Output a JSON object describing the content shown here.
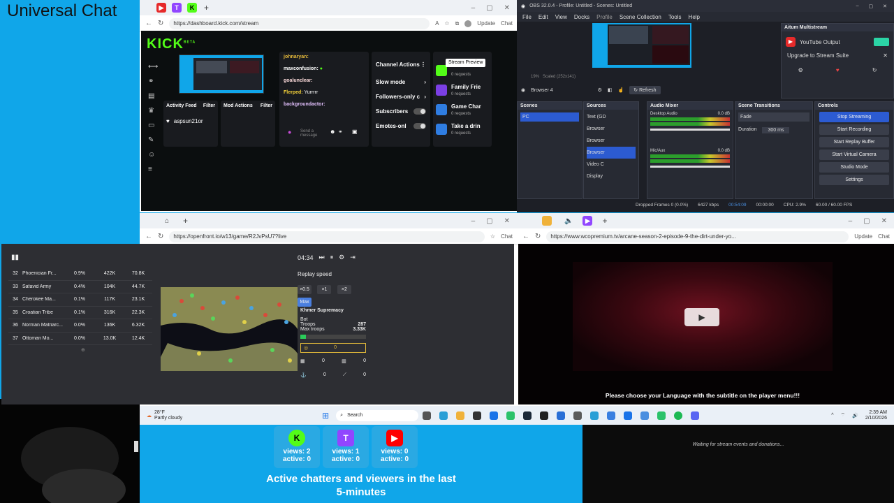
{
  "left": {
    "title": "Universal Chat"
  },
  "kick_browser": {
    "url": "https://dashboard.kick.com/stream",
    "update_label": "Update",
    "chat_label": "Chat",
    "logo": "KICK",
    "logo_badge": "BETA",
    "activity_feed": "Activity Feed",
    "filter": "Filter",
    "mod_actions": "Mod Actions",
    "sidebar_user": "aspsun21or",
    "chat": [
      {
        "user": "johnaryan:",
        "msg": ""
      },
      {
        "user": "maxconfusion:",
        "msg": ""
      },
      {
        "user": "goalunclear:",
        "msg": ""
      },
      {
        "user": "Flerped:",
        "msg": "Yurrrrr"
      },
      {
        "user": "backgroundactor:",
        "msg": ""
      }
    ],
    "send_placeholder": "Send a message",
    "channel_actions": "Channel Actions",
    "actions": [
      "Slow mode",
      "Followers-only c",
      "Subscribers",
      "Emotes-onl"
    ],
    "stream_preview": "Stream Preview",
    "quick_actions": [
      {
        "label": "Family Frie",
        "sub": "0 requests",
        "color": "#7b3fe4"
      },
      {
        "label": "Game Char",
        "sub": "0 requests",
        "color": "#2f7de1"
      },
      {
        "label": "Take a drin",
        "sub": "0 requests",
        "color": "#2f7de1"
      }
    ],
    "top_quick_sub": "0 requests"
  },
  "obs": {
    "title": "OBS 32.0.4 - Profile: Untitled - Scenes: Untitled",
    "menu": [
      "File",
      "Edit",
      "View",
      "Docks",
      "Profile",
      "Scene Collection",
      "Tools",
      "Help"
    ],
    "aitum_title": "Aitum Multistream",
    "youtube_output": "YouTube Output",
    "upgrade": "Upgrade to Stream Suite",
    "zoom": "19%",
    "scaled": "Scaled (252x141)",
    "source_name": "Browser 4",
    "refresh": "Refresh",
    "scenes_title": "Scenes",
    "scenes": [
      "PC"
    ],
    "sources_title": "Sources",
    "sources": [
      "Text (GD",
      "Browser",
      "Browser",
      "Browser",
      "Video C",
      "Display"
    ],
    "mixer_title": "Audio Mixer",
    "desktop_audio": "Desktop Audio",
    "desktop_db": "0.0 dB",
    "mic_aux": "Mic/Aux",
    "mic_db": "0.0 dB",
    "transitions_title": "Scene Transitions",
    "transition": "Fade",
    "duration_label": "Duration",
    "duration": "300 ms",
    "controls_title": "Controls",
    "controls": [
      "Stop Streaming",
      "Start Recording",
      "Start Replay Buffer",
      "Start Virtual Camera",
      "Studio Mode",
      "Settings"
    ],
    "status": {
      "dropped": "Dropped Frames 0 (0.0%)",
      "bitrate": "6427 kbps",
      "stream_time": "00:54:09",
      "rec_time": "00:00:00",
      "cpu": "CPU: 2.9%",
      "fps": "60.00 / 60.00 FPS"
    }
  },
  "game_browser": {
    "url": "https://openfront.io/w13/game/R2JvPsU7?live",
    "chat_label": "Chat",
    "leaderboard": [
      {
        "rank": "32",
        "name": "Phoenician Fr...",
        "pct": "0.9%",
        "troops": "422K",
        "gold": "70.8K"
      },
      {
        "rank": "33",
        "name": "Safavid Army",
        "pct": "0.4%",
        "troops": "104K",
        "gold": "44.7K"
      },
      {
        "rank": "34",
        "name": "Cherokee Ma...",
        "pct": "0.1%",
        "troops": "117K",
        "gold": "23.1K"
      },
      {
        "rank": "35",
        "name": "Croatian Tribe",
        "pct": "0.1%",
        "troops": "316K",
        "gold": "22.3K"
      },
      {
        "rank": "36",
        "name": "Norman Matriarc...",
        "pct": "0.0%",
        "troops": "136K",
        "gold": "6.32K"
      },
      {
        "rank": "37",
        "name": "Ottoman Mo...",
        "pct": "0.0%",
        "troops": "13.0K",
        "gold": "12.4K"
      }
    ],
    "timer": "04:34",
    "replay_speed": "Replay speed",
    "speeds": [
      "×0.5",
      "×1",
      "×2",
      "Max"
    ],
    "player_name": "Khmer Supremacy",
    "player_type": "Bot",
    "troops_label": "Troops",
    "troops": "287",
    "max_troops_label": "Max troops",
    "max_troops": "3.33K",
    "gold": "0",
    "counts": [
      "0",
      "0",
      "0",
      "0"
    ]
  },
  "video_browser": {
    "url": "https://www.wcopremium.tv/arcane-season-2-episode-9-the-dirt-under-yo...",
    "update_label": "Update",
    "chat_label": "Chat",
    "subtitle_notice": "Please choose your Language with the subtitle on the player menu!!!"
  },
  "taskbar": {
    "weather_temp": "28°F",
    "weather_desc": "Partly cloudy",
    "search": "Search",
    "time": "2:39 AM",
    "date": "2/10/2026"
  },
  "viewers": {
    "platforms": [
      {
        "name": "kick",
        "views": "views: 2",
        "active": "active: 0",
        "color": "#53fc18"
      },
      {
        "name": "twitch",
        "views": "views: 1",
        "active": "active: 0",
        "color": "#9146ff"
      },
      {
        "name": "youtube",
        "views": "views: 0",
        "active": "active: 0",
        "color": "#ff0000"
      }
    ],
    "title_line1": "Active chatters and viewers in the last",
    "title_line2": "5-minutes"
  },
  "donations": {
    "text": "Waiting for stream events and donations..."
  }
}
